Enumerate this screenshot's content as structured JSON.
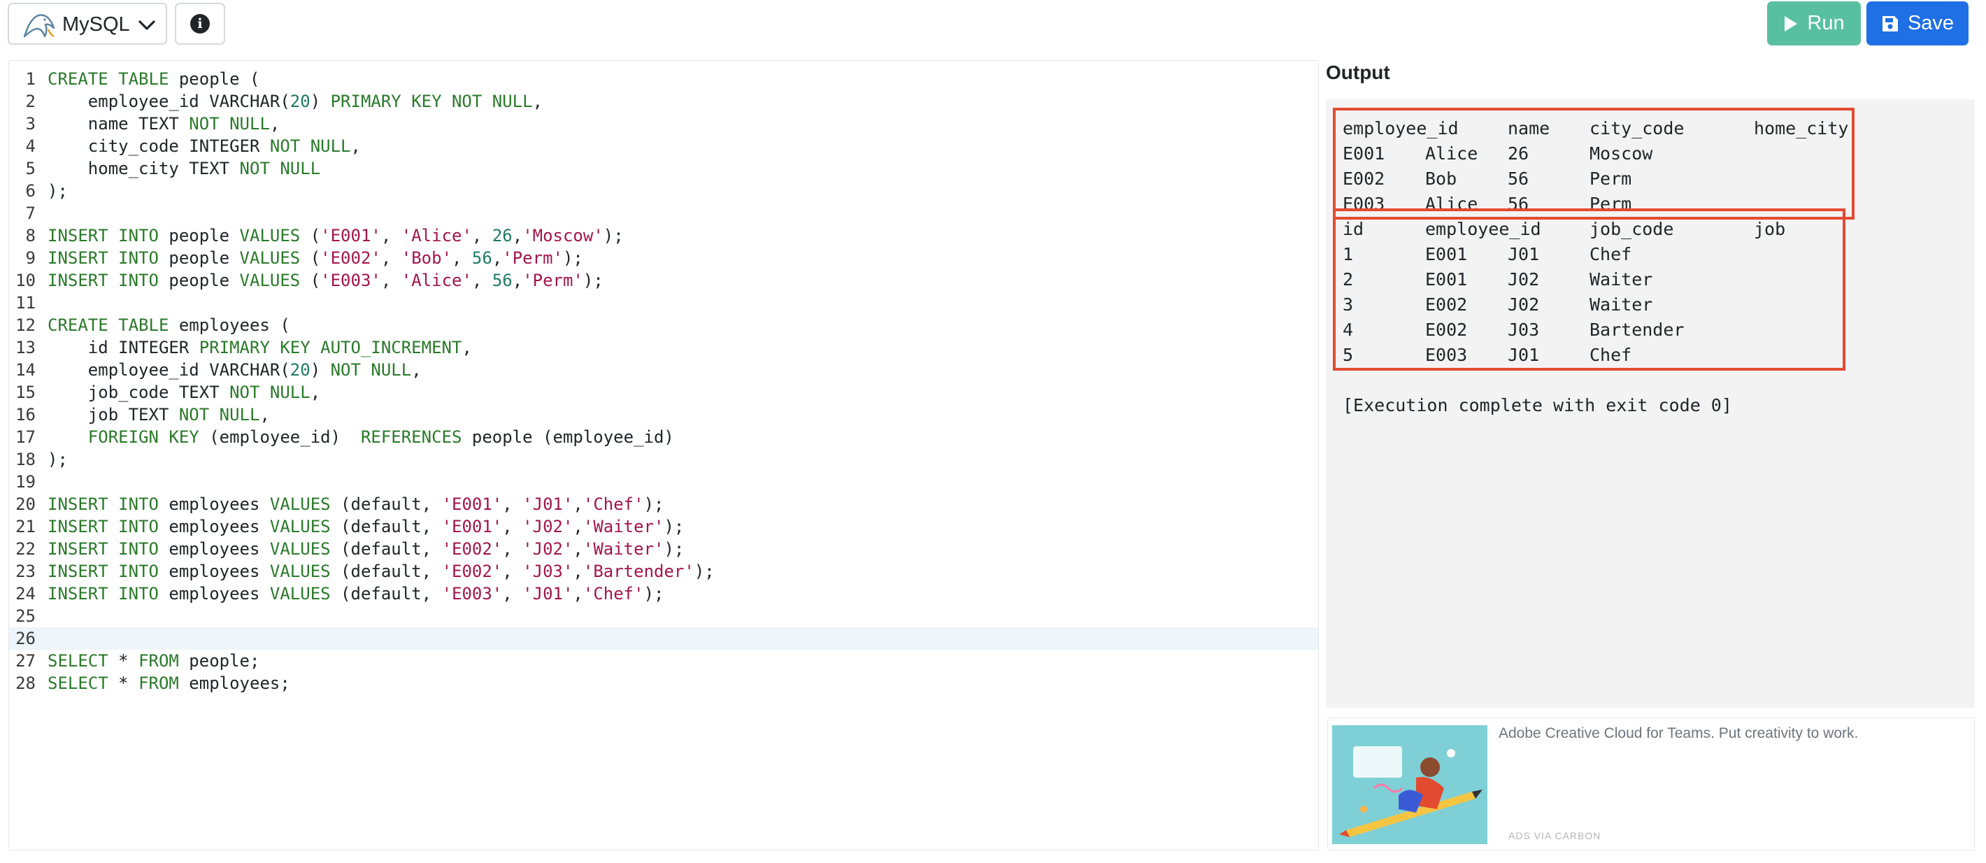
{
  "toolbar": {
    "language": "MySQL",
    "run_label": "Run",
    "save_label": "Save"
  },
  "editor": {
    "active_line": 26,
    "lines": [
      {
        "n": "1",
        "tokens": [
          [
            "kw",
            "CREATE TABLE"
          ],
          [
            "t",
            " people ("
          ]
        ]
      },
      {
        "n": "2",
        "tokens": [
          [
            "t",
            "    employee_id VARCHAR("
          ],
          [
            "num",
            "20"
          ],
          [
            "t",
            ") "
          ],
          [
            "kw",
            "PRIMARY KEY NOT NULL"
          ],
          [
            "t",
            ","
          ]
        ]
      },
      {
        "n": "3",
        "tokens": [
          [
            "t",
            "    name TEXT "
          ],
          [
            "kw",
            "NOT NULL"
          ],
          [
            "t",
            ","
          ]
        ]
      },
      {
        "n": "4",
        "tokens": [
          [
            "t",
            "    city_code INTEGER "
          ],
          [
            "kw",
            "NOT NULL"
          ],
          [
            "t",
            ","
          ]
        ]
      },
      {
        "n": "5",
        "tokens": [
          [
            "t",
            "    home_city TEXT "
          ],
          [
            "kw",
            "NOT NULL"
          ]
        ]
      },
      {
        "n": "6",
        "tokens": [
          [
            "t",
            ");"
          ]
        ]
      },
      {
        "n": "7",
        "tokens": []
      },
      {
        "n": "8",
        "tokens": [
          [
            "kw",
            "INSERT INTO"
          ],
          [
            "t",
            " people "
          ],
          [
            "kw",
            "VALUES"
          ],
          [
            "t",
            " ("
          ],
          [
            "str",
            "'E001'"
          ],
          [
            "t",
            ", "
          ],
          [
            "str",
            "'Alice'"
          ],
          [
            "t",
            ", "
          ],
          [
            "num",
            "26"
          ],
          [
            "t",
            ","
          ],
          [
            "str",
            "'Moscow'"
          ],
          [
            "t",
            ");"
          ]
        ]
      },
      {
        "n": "9",
        "tokens": [
          [
            "kw",
            "INSERT INTO"
          ],
          [
            "t",
            " people "
          ],
          [
            "kw",
            "VALUES"
          ],
          [
            "t",
            " ("
          ],
          [
            "str",
            "'E002'"
          ],
          [
            "t",
            ", "
          ],
          [
            "str",
            "'Bob'"
          ],
          [
            "t",
            ", "
          ],
          [
            "num",
            "56"
          ],
          [
            "t",
            ","
          ],
          [
            "str",
            "'Perm'"
          ],
          [
            "t",
            ");"
          ]
        ]
      },
      {
        "n": "10",
        "tokens": [
          [
            "kw",
            "INSERT INTO"
          ],
          [
            "t",
            " people "
          ],
          [
            "kw",
            "VALUES"
          ],
          [
            "t",
            " ("
          ],
          [
            "str",
            "'E003'"
          ],
          [
            "t",
            ", "
          ],
          [
            "str",
            "'Alice'"
          ],
          [
            "t",
            ", "
          ],
          [
            "num",
            "56"
          ],
          [
            "t",
            ","
          ],
          [
            "str",
            "'Perm'"
          ],
          [
            "t",
            ");"
          ]
        ]
      },
      {
        "n": "11",
        "tokens": []
      },
      {
        "n": "12",
        "tokens": [
          [
            "kw",
            "CREATE TABLE"
          ],
          [
            "t",
            " employees ("
          ]
        ]
      },
      {
        "n": "13",
        "tokens": [
          [
            "t",
            "    id INTEGER "
          ],
          [
            "kw",
            "PRIMARY KEY AUTO_INCREMENT"
          ],
          [
            "t",
            ","
          ]
        ]
      },
      {
        "n": "14",
        "tokens": [
          [
            "t",
            "    employee_id VARCHAR("
          ],
          [
            "num",
            "20"
          ],
          [
            "t",
            ") "
          ],
          [
            "kw",
            "NOT NULL"
          ],
          [
            "t",
            ","
          ]
        ]
      },
      {
        "n": "15",
        "tokens": [
          [
            "t",
            "    job_code TEXT "
          ],
          [
            "kw",
            "NOT NULL"
          ],
          [
            "t",
            ","
          ]
        ]
      },
      {
        "n": "16",
        "tokens": [
          [
            "t",
            "    job TEXT "
          ],
          [
            "kw",
            "NOT NULL"
          ],
          [
            "t",
            ","
          ]
        ]
      },
      {
        "n": "17",
        "tokens": [
          [
            "t",
            "    "
          ],
          [
            "kw",
            "FOREIGN KEY"
          ],
          [
            "t",
            " (employee_id)  "
          ],
          [
            "kw",
            "REFERENCES"
          ],
          [
            "t",
            " people (employee_id)"
          ]
        ]
      },
      {
        "n": "18",
        "tokens": [
          [
            "t",
            ");"
          ]
        ]
      },
      {
        "n": "19",
        "tokens": []
      },
      {
        "n": "20",
        "tokens": [
          [
            "kw",
            "INSERT INTO"
          ],
          [
            "t",
            " employees "
          ],
          [
            "kw",
            "VALUES"
          ],
          [
            "t",
            " (default, "
          ],
          [
            "str",
            "'E001'"
          ],
          [
            "t",
            ", "
          ],
          [
            "str",
            "'J01'"
          ],
          [
            "t",
            ","
          ],
          [
            "str",
            "'Chef'"
          ],
          [
            "t",
            ");"
          ]
        ]
      },
      {
        "n": "21",
        "tokens": [
          [
            "kw",
            "INSERT INTO"
          ],
          [
            "t",
            " employees "
          ],
          [
            "kw",
            "VALUES"
          ],
          [
            "t",
            " (default, "
          ],
          [
            "str",
            "'E001'"
          ],
          [
            "t",
            ", "
          ],
          [
            "str",
            "'J02'"
          ],
          [
            "t",
            ","
          ],
          [
            "str",
            "'Waiter'"
          ],
          [
            "t",
            ");"
          ]
        ]
      },
      {
        "n": "22",
        "tokens": [
          [
            "kw",
            "INSERT INTO"
          ],
          [
            "t",
            " employees "
          ],
          [
            "kw",
            "VALUES"
          ],
          [
            "t",
            " (default, "
          ],
          [
            "str",
            "'E002'"
          ],
          [
            "t",
            ", "
          ],
          [
            "str",
            "'J02'"
          ],
          [
            "t",
            ","
          ],
          [
            "str",
            "'Waiter'"
          ],
          [
            "t",
            ");"
          ]
        ]
      },
      {
        "n": "23",
        "tokens": [
          [
            "kw",
            "INSERT INTO"
          ],
          [
            "t",
            " employees "
          ],
          [
            "kw",
            "VALUES"
          ],
          [
            "t",
            " (default, "
          ],
          [
            "str",
            "'E002'"
          ],
          [
            "t",
            ", "
          ],
          [
            "str",
            "'J03'"
          ],
          [
            "t",
            ","
          ],
          [
            "str",
            "'Bartender'"
          ],
          [
            "t",
            ");"
          ]
        ]
      },
      {
        "n": "24",
        "tokens": [
          [
            "kw",
            "INSERT INTO"
          ],
          [
            "t",
            " employees "
          ],
          [
            "kw",
            "VALUES"
          ],
          [
            "t",
            " (default, "
          ],
          [
            "str",
            "'E003'"
          ],
          [
            "t",
            ", "
          ],
          [
            "str",
            "'J01'"
          ],
          [
            "t",
            ","
          ],
          [
            "str",
            "'Chef'"
          ],
          [
            "t",
            ");"
          ]
        ]
      },
      {
        "n": "25",
        "tokens": []
      },
      {
        "n": "26",
        "tokens": []
      },
      {
        "n": "27",
        "tokens": [
          [
            "kw",
            "SELECT"
          ],
          [
            "t",
            " * "
          ],
          [
            "kw",
            "FROM"
          ],
          [
            "t",
            " people;"
          ]
        ]
      },
      {
        "n": "28",
        "tokens": [
          [
            "kw",
            "SELECT"
          ],
          [
            "t",
            " * "
          ],
          [
            "kw",
            "FROM"
          ],
          [
            "t",
            " employees;"
          ]
        ]
      }
    ]
  },
  "output": {
    "title": "Output",
    "tables": [
      {
        "columns": [
          "employee_id",
          "name",
          "city_code",
          "home_city"
        ],
        "rows": [
          [
            "E001",
            "Alice",
            "26",
            "Moscow"
          ],
          [
            "E002",
            "Bob",
            "56",
            "Perm"
          ],
          [
            "E003",
            "Alice",
            "56",
            "Perm"
          ]
        ]
      },
      {
        "columns": [
          "id",
          "employee_id",
          "job_code",
          "job"
        ],
        "rows": [
          [
            "1",
            "E001",
            "J01",
            "Chef"
          ],
          [
            "2",
            "E001",
            "J02",
            "Waiter"
          ],
          [
            "3",
            "E002",
            "J02",
            "Waiter"
          ],
          [
            "4",
            "E002",
            "J03",
            "Bartender"
          ],
          [
            "5",
            "E003",
            "J01",
            "Chef"
          ]
        ]
      }
    ],
    "status": "[Execution complete with exit code 0]"
  },
  "ad": {
    "text": "Adobe Creative Cloud for Teams. Put creativity to work.",
    "via": "ADS VIA CARBON"
  },
  "colors": {
    "run": "#58c0a0",
    "save": "#1f6fe5",
    "highlight_box": "#e34b31",
    "keyword": "#2a7a2a",
    "string": "#a3154a",
    "number": "#1f7a64"
  }
}
